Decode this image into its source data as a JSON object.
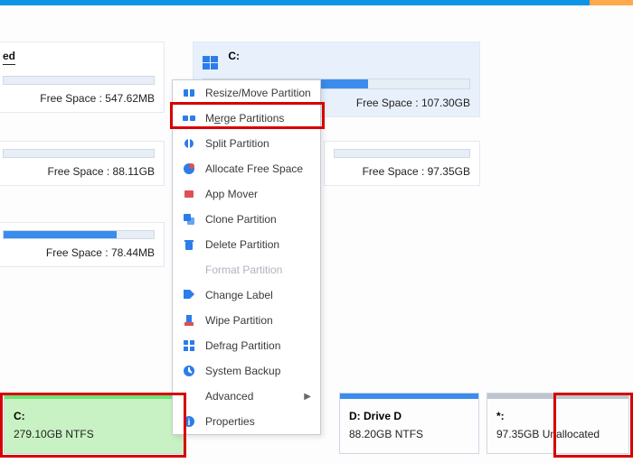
{
  "panels": {
    "p1": {
      "header": "ed",
      "free_label": "Free Space : 547.62MB",
      "fill_pct": 0
    },
    "p2": {
      "header": "",
      "free_label": "Free Space : 88.11GB",
      "fill_pct": 0
    },
    "p3": {
      "header": "",
      "free_label": "Free Space : 78.44MB",
      "fill_pct": 75
    },
    "cpanel": {
      "header": "C:",
      "free_label": "Free Space : 107.30GB",
      "fill_pct": 62
    },
    "p5": {
      "header": "",
      "free_label": "Free Space : 97.35GB",
      "fill_pct": 0
    }
  },
  "ctx": {
    "resize": "Resize/Move Partition",
    "merge_pre": "M",
    "merge_u": "e",
    "merge_post": "rge Partitions",
    "split": "Split Partition",
    "allocate": "Allocate Free Space",
    "appmover": "App Mover",
    "clone": "Clone Partition",
    "delete": "Delete Partition",
    "format": "Format Partition",
    "label": "Change Label",
    "wipe": "Wipe Partition",
    "defrag": "Defrag Partition",
    "backup": "System Backup",
    "advanced": "Advanced",
    "properties": "Properties"
  },
  "disk": {
    "c_title": "C:",
    "c_sub": "279.10GB NTFS",
    "d_title": "D: Drive D",
    "d_sub": "88.20GB NTFS",
    "u_title": "*:",
    "u_sub": "97.35GB Unallocated"
  }
}
